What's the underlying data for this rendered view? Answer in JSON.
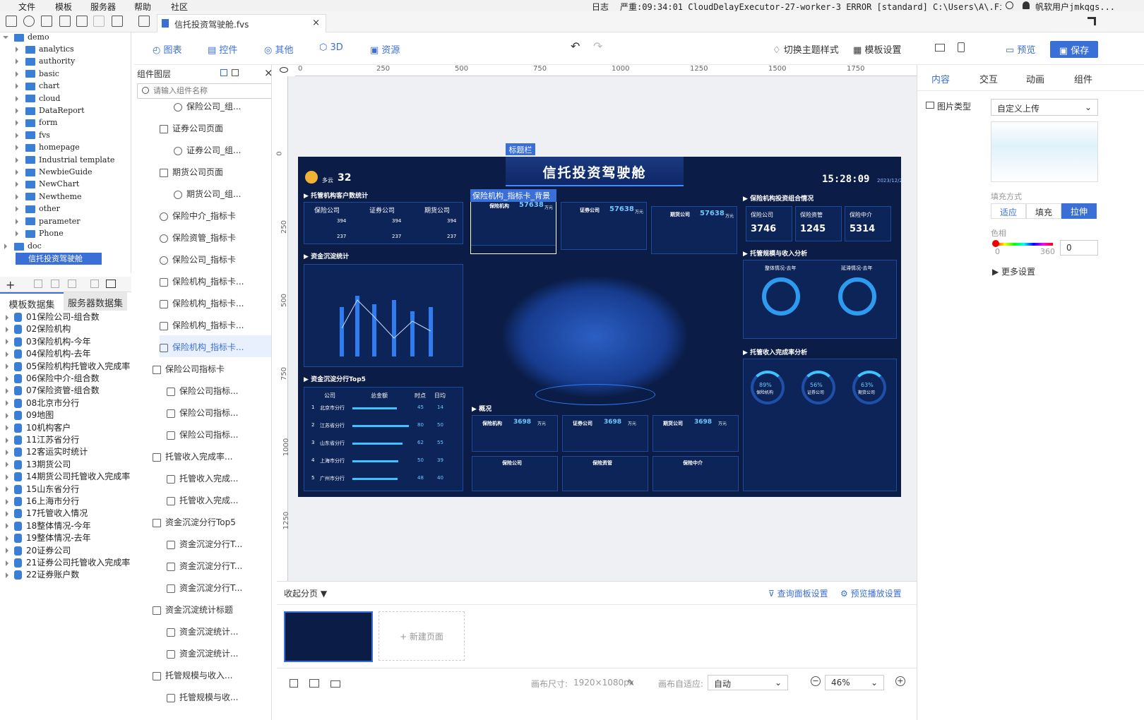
{
  "menu": {
    "items": [
      "文件",
      "模板",
      "服务器",
      "帮助",
      "社区"
    ]
  },
  "status": {
    "log": "日志",
    "message": "严重:09:34:01 CloudDelayExecutor-27-worker-3 ERROR [standard] C:\\Users\\A\\.FineReport110\\bc...",
    "user": "帆软用户jmkqgs..."
  },
  "file_tab": {
    "name": "信托投资驾驶舱.fvs"
  },
  "tree": {
    "root": "demo",
    "items": [
      "analytics",
      "authority",
      "basic",
      "chart",
      "cloud",
      "DataReport",
      "form",
      "fvs",
      "homepage",
      "Industrial template",
      "NewbieGuide",
      "NewChart",
      "Newtheme",
      "other",
      "parameter",
      "Phone"
    ],
    "doc": "doc",
    "selected": "信托投资驾驶舱"
  },
  "datasets": {
    "tabs": [
      "模板数据集",
      "服务器数据集"
    ],
    "items": [
      "01保险公司-组合数",
      "02保险机构",
      "03保险机构-今年",
      "04保险机构-去年",
      "05保险机构托管收入完成率",
      "06保险中介-组合数",
      "07保险资管-组合数",
      "08北京市分行",
      "09地图",
      "10机构客户",
      "11江苏省分行",
      "12客运实时统计",
      "13期货公司",
      "14期货公司托管收入完成率",
      "15山东省分行",
      "16上海市分行",
      "17托管收入情况",
      "18整体情况-今年",
      "19整体情况-去年",
      "20证券公司",
      "21证券公司托管收入完成率",
      "22证券账户数"
    ]
  },
  "layers": {
    "title": "组件图层",
    "search_placeholder": "请输入组件名称",
    "items": [
      "保险公司_组...",
      "证券公司页面",
      "证券公司_组...",
      "期货公司页面",
      "期货公司_组...",
      "保险中介_指标卡",
      "保险资管_指标卡",
      "保险公司_指标卡",
      "保险机构_指标卡...",
      "保险机构_指标卡...",
      "保险机构_指标卡...",
      "保险机构_指标卡...",
      "保险公司指标卡",
      "保险公司指标...",
      "保险公司指标...",
      "保险公司指标...",
      "托管收入完成率...",
      "托管收入完成...",
      "托管收入完成...",
      "资金沉淀分行Top5",
      "资金沉淀分行T...",
      "资金沉淀分行T...",
      "资金沉淀分行T...",
      "资金沉淀统计标题",
      "资金沉淀统计...",
      "资金沉淀统计...",
      "托管规模与收入...",
      "托管规模与收..."
    ]
  },
  "topnav": {
    "left": [
      "图表",
      "控件",
      "其他",
      "3D",
      "资源"
    ],
    "theme": "切换主题样式",
    "template_settings": "模板设置",
    "preview": "预览",
    "save": "保存"
  },
  "ruler": {
    "h": [
      "0",
      "250",
      "500",
      "750",
      "1000",
      "1250",
      "1500",
      "1750"
    ],
    "v": [
      "0",
      "250",
      "500",
      "750",
      "1000",
      "1250"
    ]
  },
  "dashboard": {
    "title": "信托投资驾驶舱",
    "label_title": "标题栏",
    "label_selected": "保险机构_指标卡_背景",
    "weather": "多云",
    "temp": "32",
    "time": "15:28:09",
    "date": "2023/12/2",
    "section_customers": "托管机构客户数统计",
    "section_deposit": "资金沉淀统计",
    "section_top5": "资金沉淀分行Top5",
    "section_insurance": "保险机构投资组合情况",
    "section_scale": "托管规模与收入分析",
    "section_completion": "托管收入完成率分析",
    "section_overview": "概况",
    "cust_tabs": [
      "保险公司",
      "证券公司",
      "期货公司"
    ],
    "cust_vals": [
      "394",
      "394",
      "394"
    ],
    "cust_eva": [
      "237",
      "237",
      "237"
    ],
    "kpi_cards": [
      {
        "name": "保险机构",
        "value": "57638",
        "unit": "万元"
      },
      {
        "name": "证券公司",
        "value": "57638",
        "unit": "万元"
      },
      {
        "name": "期货公司",
        "value": "57638",
        "unit": "万元"
      }
    ],
    "insurance_stats": [
      {
        "label": "保险公司",
        "value": "3746"
      },
      {
        "label": "保险资管",
        "value": "1245"
      },
      {
        "label": "保险中介",
        "value": "5314"
      }
    ],
    "donut_labels": [
      "整体情况-去年",
      "延滞情况-去年"
    ],
    "completion": [
      {
        "name": "保险机构",
        "pct": "89%"
      },
      {
        "name": "证券公司",
        "pct": "56%"
      },
      {
        "name": "期货公司",
        "pct": "63%"
      }
    ],
    "top5": {
      "headers": [
        "公司",
        "总金额",
        "时点",
        "日均"
      ],
      "rows": [
        {
          "rank": "1",
          "name": "北京市分行",
          "a": "45",
          "b": "14"
        },
        {
          "rank": "2",
          "name": "江苏省分行",
          "a": "80",
          "b": "50"
        },
        {
          "rank": "3",
          "name": "山东省分行",
          "a": "62",
          "b": "55"
        },
        {
          "rank": "4",
          "name": "上海市分行",
          "a": "50",
          "b": "39"
        },
        {
          "rank": "5",
          "name": "广州市分行",
          "a": "48",
          "b": "40"
        }
      ]
    },
    "overview_cards": [
      {
        "name": "保险机构",
        "value": "3698",
        "unit": "万元"
      },
      {
        "name": "证券公司",
        "value": "3698",
        "unit": "万元"
      },
      {
        "name": "期货公司",
        "value": "3698",
        "unit": "万元"
      }
    ],
    "overview_bottom": [
      "保险公司",
      "保险资管",
      "保险中介"
    ]
  },
  "right": {
    "tabs": [
      "内容",
      "交互",
      "动画",
      "组件"
    ],
    "image_type_label": "图片类型",
    "image_type_value": "自定义上传",
    "fill_label": "填充方式",
    "fill_opts": [
      "适应",
      "填充",
      "拉伸"
    ],
    "hue_label": "色相",
    "hue_min": "0",
    "hue_max": "360",
    "hue_value": "0",
    "more": "更多设置"
  },
  "bottom": {
    "collapse": "收起分页",
    "query_panel": "查询面板设置",
    "preview_play": "预览播放设置",
    "new_page": "+ 新建页面",
    "canvas_size_label": "画布尺寸:",
    "canvas_size": "1920×1080px",
    "fit_label": "画布自适应:",
    "fit_value": "自动",
    "zoom": "46%"
  }
}
